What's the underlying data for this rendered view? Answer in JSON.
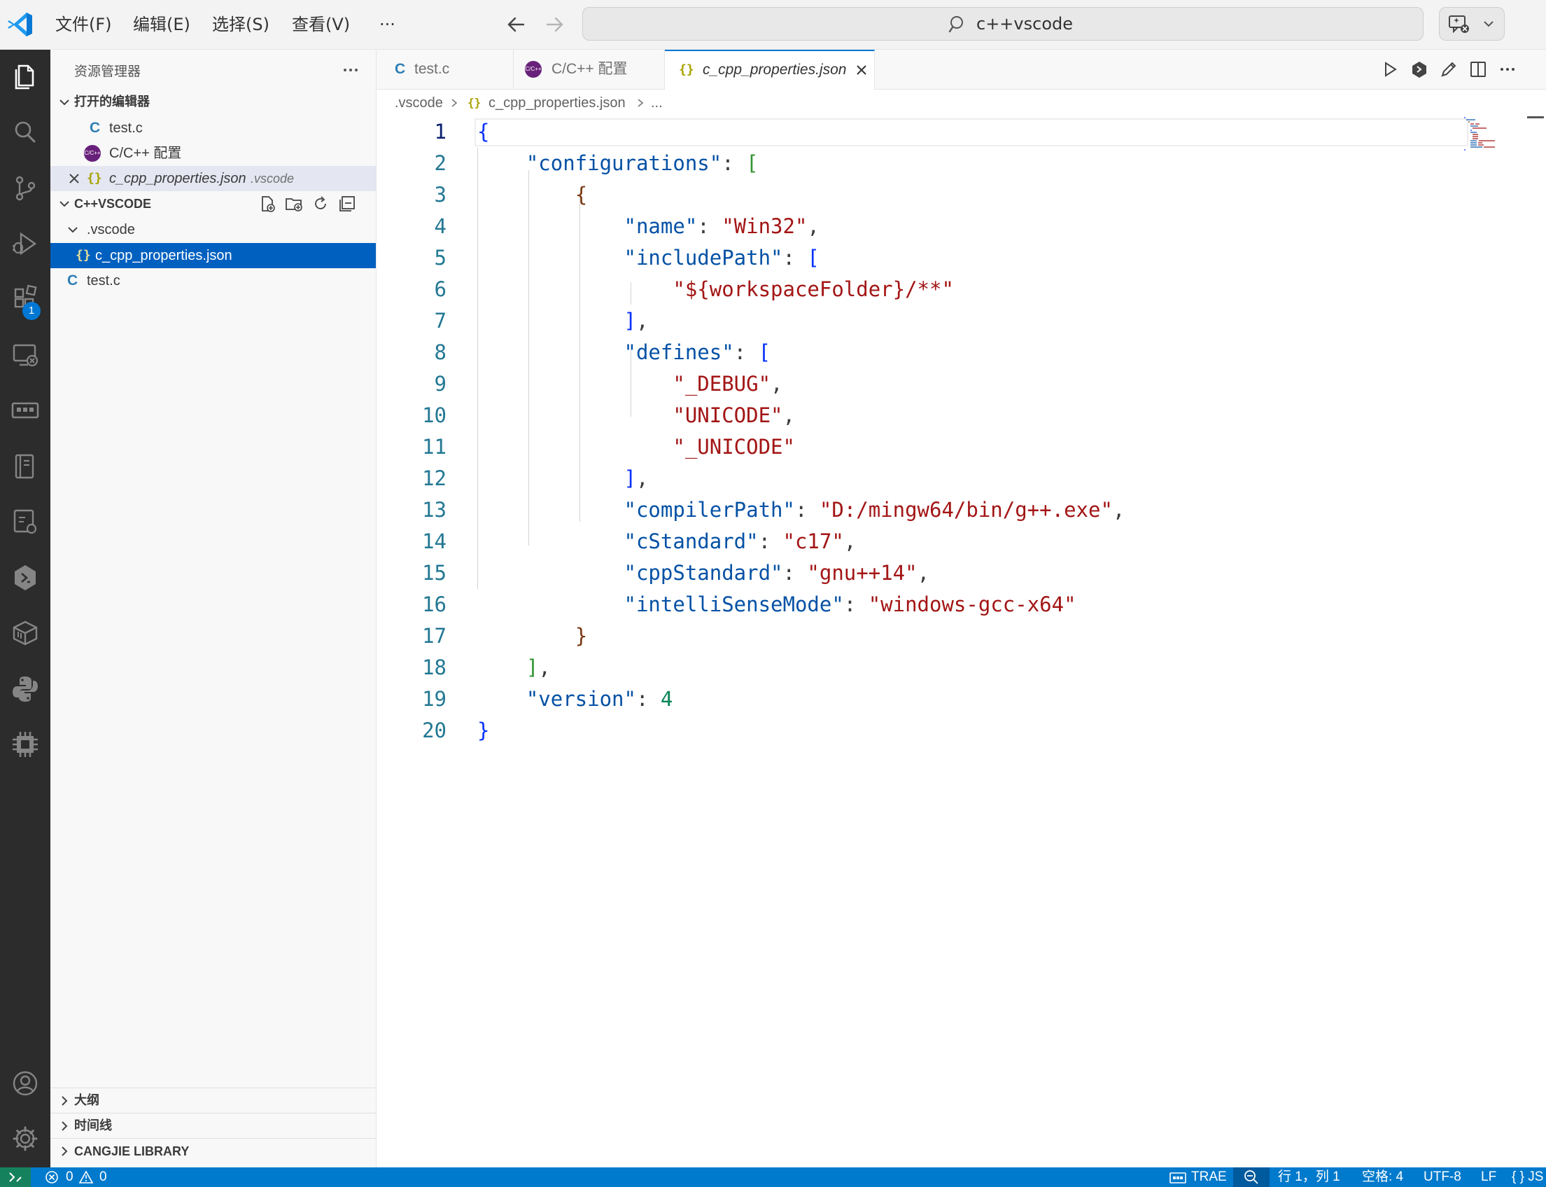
{
  "menubar": {
    "items": [
      "文件(F)",
      "编辑(E)",
      "选择(S)",
      "查看(V)",
      "···"
    ],
    "search_text": "c++vscode"
  },
  "colors": {
    "accent": "#0078d4",
    "status_bar": "#007acc",
    "selection": "#0060c0",
    "activity_bar": "#2c2c2c"
  },
  "activity_bar": {
    "icons": [
      "files-icon",
      "search-icon",
      "source-control-icon",
      "run-debug-icon",
      "extensions-icon",
      "remote-explorer-icon",
      "ports-icon",
      "notebook-icon",
      "cmake-icon",
      "cangjie-icon",
      "package-icon",
      "python-icon",
      "chip-icon",
      "account-icon",
      "settings-gear-icon"
    ],
    "extensions_badge": "1"
  },
  "sidebar": {
    "title": "资源管理器",
    "open_editors": {
      "label": "打开的编辑器",
      "items": [
        {
          "name": "test.c",
          "desc": ""
        },
        {
          "name": "C/C++ 配置",
          "desc": ""
        },
        {
          "name": "c_cpp_properties.json",
          "desc": ".vscode"
        }
      ]
    },
    "workspace": {
      "label": "C++VSCODE",
      "folder": ".vscode",
      "selected_file": "c_cpp_properties.json",
      "file": "test.c"
    },
    "bottom_sections": [
      "大纲",
      "时间线",
      "CANGJIE LIBRARY"
    ]
  },
  "tabs": [
    {
      "label": "test.c",
      "active": false
    },
    {
      "label": "C/C++ 配置",
      "active": false
    },
    {
      "label": "c_cpp_properties.json",
      "active": true
    }
  ],
  "config_icon_text": "C/C++",
  "breadcrumb": [
    ".vscode",
    "c_cpp_properties.json",
    "..."
  ],
  "editor": {
    "line_numbers": [
      "1",
      "2",
      "3",
      "4",
      "5",
      "6",
      "7",
      "8",
      "9",
      "10",
      "11",
      "12",
      "13",
      "14",
      "15",
      "16",
      "17",
      "18",
      "19",
      "20"
    ],
    "current_line": "1",
    "code": {
      "configurations_key": "\"configurations\"",
      "name_key": "\"name\"",
      "name_val": "\"Win32\"",
      "include_key": "\"includePath\"",
      "include_val": "\"${workspaceFolder}/**\"",
      "defines_key": "\"defines\"",
      "define_1": "\"_DEBUG\"",
      "define_2": "\"UNICODE\"",
      "define_3": "\"_UNICODE\"",
      "compiler_key": "\"compilerPath\"",
      "compiler_val": "\"D:/mingw64/bin/g++.exe\"",
      "cstd_key": "\"cStandard\"",
      "cstd_val": "\"c17\"",
      "cppstd_key": "\"cppStandard\"",
      "cppstd_val": "\"gnu++14\"",
      "isense_key": "\"intelliSenseMode\"",
      "isense_val": "\"windows-gcc-x64\"",
      "version_key": "\"version\"",
      "version_val": "4"
    }
  },
  "statusbar": {
    "errors": "0",
    "warnings": "0",
    "trae": "TRAE",
    "cursor": "行 1，列 1",
    "spaces": "空格: 4",
    "encoding": "UTF-8",
    "eol": "LF",
    "language": "{ } JS"
  }
}
